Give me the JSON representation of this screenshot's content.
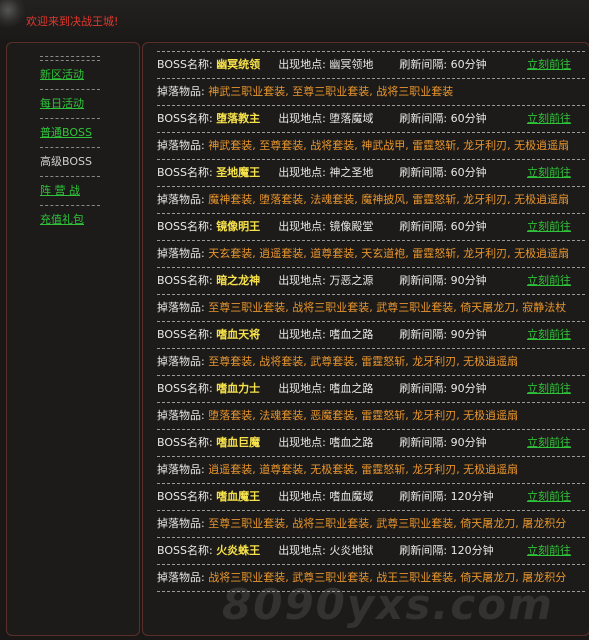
{
  "welcome": "欢迎来到决战王城!",
  "menu": [
    {
      "label": "新区活动",
      "active": false
    },
    {
      "label": "每日活动",
      "active": false
    },
    {
      "label": "普通BOSS",
      "active": false
    },
    {
      "label": "高级BOSS",
      "active": true
    },
    {
      "label": "阵 营 战",
      "active": false
    },
    {
      "label": "充值礼包",
      "active": false
    }
  ],
  "labels": {
    "boss": "BOSS名称:",
    "location": "出现地点:",
    "interval": "刷新间隔:",
    "drops": "掉落物品:",
    "go": "立刻前往"
  },
  "bosses": [
    {
      "name": "幽冥统领",
      "location": "幽冥领地",
      "interval": "60分钟",
      "drops": "神武三职业套装, 至尊三职业套装, 战将三职业套装"
    },
    {
      "name": "堕落教主",
      "location": "堕落魔域",
      "interval": "60分钟",
      "drops": "神武套装, 至尊套装, 战将套装, 神武战甲, 雷霆怒斩, 龙牙利刃, 无极逍遥扇"
    },
    {
      "name": "圣地魔王",
      "location": "神之圣地",
      "interval": "60分钟",
      "drops": "魔神套装, 堕落套装, 法魂套装, 魔神披风, 雷霆怒斩, 龙牙利刃, 无极逍遥扇"
    },
    {
      "name": "镜像明王",
      "location": "镜像殿堂",
      "interval": "60分钟",
      "drops": "天玄套装, 逍遥套装, 道尊套装, 天玄道袍, 雷霆怒斩, 龙牙利刃, 无极逍遥扇"
    },
    {
      "name": "暗之龙神",
      "location": "万恶之源",
      "interval": "90分钟",
      "drops": "至尊三职业套装, 战将三职业套装, 武尊三职业套装, 倚天屠龙刀, 寂静法杖"
    },
    {
      "name": "嗜血天将",
      "location": "嗜血之路",
      "interval": "90分钟",
      "drops": "至尊套装, 战将套装, 武尊套装, 雷霆怒斩, 龙牙利刃, 无极逍遥扇"
    },
    {
      "name": "嗜血力士",
      "location": "嗜血之路",
      "interval": "90分钟",
      "drops": "堕落套装, 法魂套装, 恶魔套装, 雷霆怒斩, 龙牙利刃, 无极逍遥扇"
    },
    {
      "name": "嗜血巨魔",
      "location": "嗜血之路",
      "interval": "90分钟",
      "drops": "逍遥套装, 道尊套装, 无极套装, 雷霆怒斩, 龙牙利刃, 无极逍遥扇"
    },
    {
      "name": "嗜血魔王",
      "location": "嗜血魔域",
      "interval": "120分钟",
      "drops": "至尊三职业套装, 战将三职业套装, 武尊三职业套装, 倚天屠龙刀, 屠龙积分"
    },
    {
      "name": "火炎蛛王",
      "location": "火炎地狱",
      "interval": "120分钟",
      "drops": "战将三职业套装, 武尊三职业套装, 战王三职业套装, 倚天屠龙刀, 屠龙积分"
    }
  ],
  "watermark": "8090yxs.com",
  "colors": {
    "background": "#1a1816",
    "panel_border": "#5a2f2a",
    "boss_name": "#f6e24a",
    "drops": "#e7952e",
    "link": "#2fc33a",
    "welcome": "#e0372c"
  }
}
